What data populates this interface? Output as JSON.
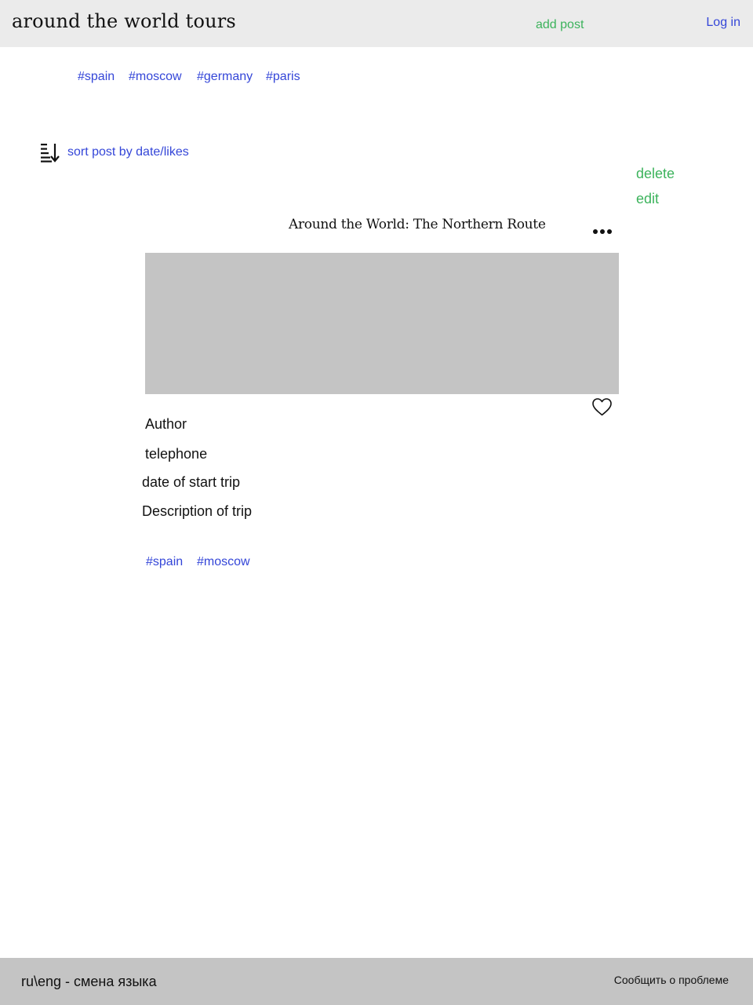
{
  "header": {
    "logo": "around the world tours",
    "add_post": "add post",
    "login": "Log in"
  },
  "top_tags": [
    "#spain",
    "#moscow",
    "#germany",
    "#paris"
  ],
  "sort": {
    "icon": "sort-descending-icon",
    "label": "sort post by date/likes"
  },
  "post_menu": {
    "delete": "delete",
    "edit": "edit"
  },
  "post": {
    "title": "Around the World: The Northern Route",
    "more_icon": "more-horizontal-icon",
    "like_icon": "heart-icon",
    "author": "Author",
    "telephone": "telephone",
    "date": "date of start trip",
    "description": "Description of trip",
    "tags": [
      "#spain",
      "#moscow"
    ]
  },
  "footer": {
    "language": "ru\\eng - смена языка",
    "report": "Сообщить о проблеме"
  },
  "colors": {
    "header_bg": "#ebebeb",
    "footer_bg": "#c4c4c4",
    "image_placeholder": "#c4c4c4",
    "link_blue": "#3446d8",
    "action_green": "#3cb35c"
  }
}
